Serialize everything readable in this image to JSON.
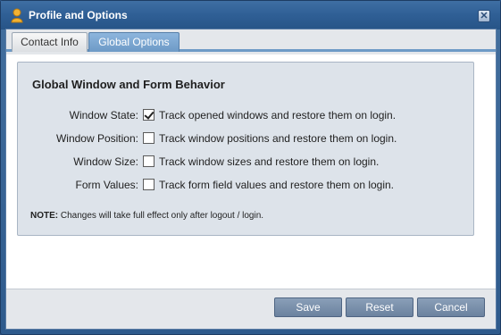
{
  "window": {
    "title": "Profile and Options",
    "icon": "user-icon",
    "close_icon": "close-icon"
  },
  "tabs": [
    {
      "label": "Contact Info",
      "active": false
    },
    {
      "label": "Global Options",
      "active": true
    }
  ],
  "panel": {
    "heading": "Global Window and Form Behavior",
    "rows": [
      {
        "label": "Window State:",
        "checked": true,
        "description": "Track opened windows and restore them on login."
      },
      {
        "label": "Window Position:",
        "checked": false,
        "description": "Track window positions and restore them on login."
      },
      {
        "label": "Window Size:",
        "checked": false,
        "description": "Track window sizes and restore them on login."
      },
      {
        "label": "Form Values:",
        "checked": false,
        "description": "Track form field values and restore them on login."
      }
    ],
    "note_prefix": "NOTE:",
    "note_text": " Changes will take full effect only after logout / login."
  },
  "buttons": {
    "save": "Save",
    "reset": "Reset",
    "cancel": "Cancel"
  },
  "colors": {
    "titlebar": "#2f5f95",
    "active_tab": "#6d9ac6",
    "button": "#7a91ad"
  }
}
